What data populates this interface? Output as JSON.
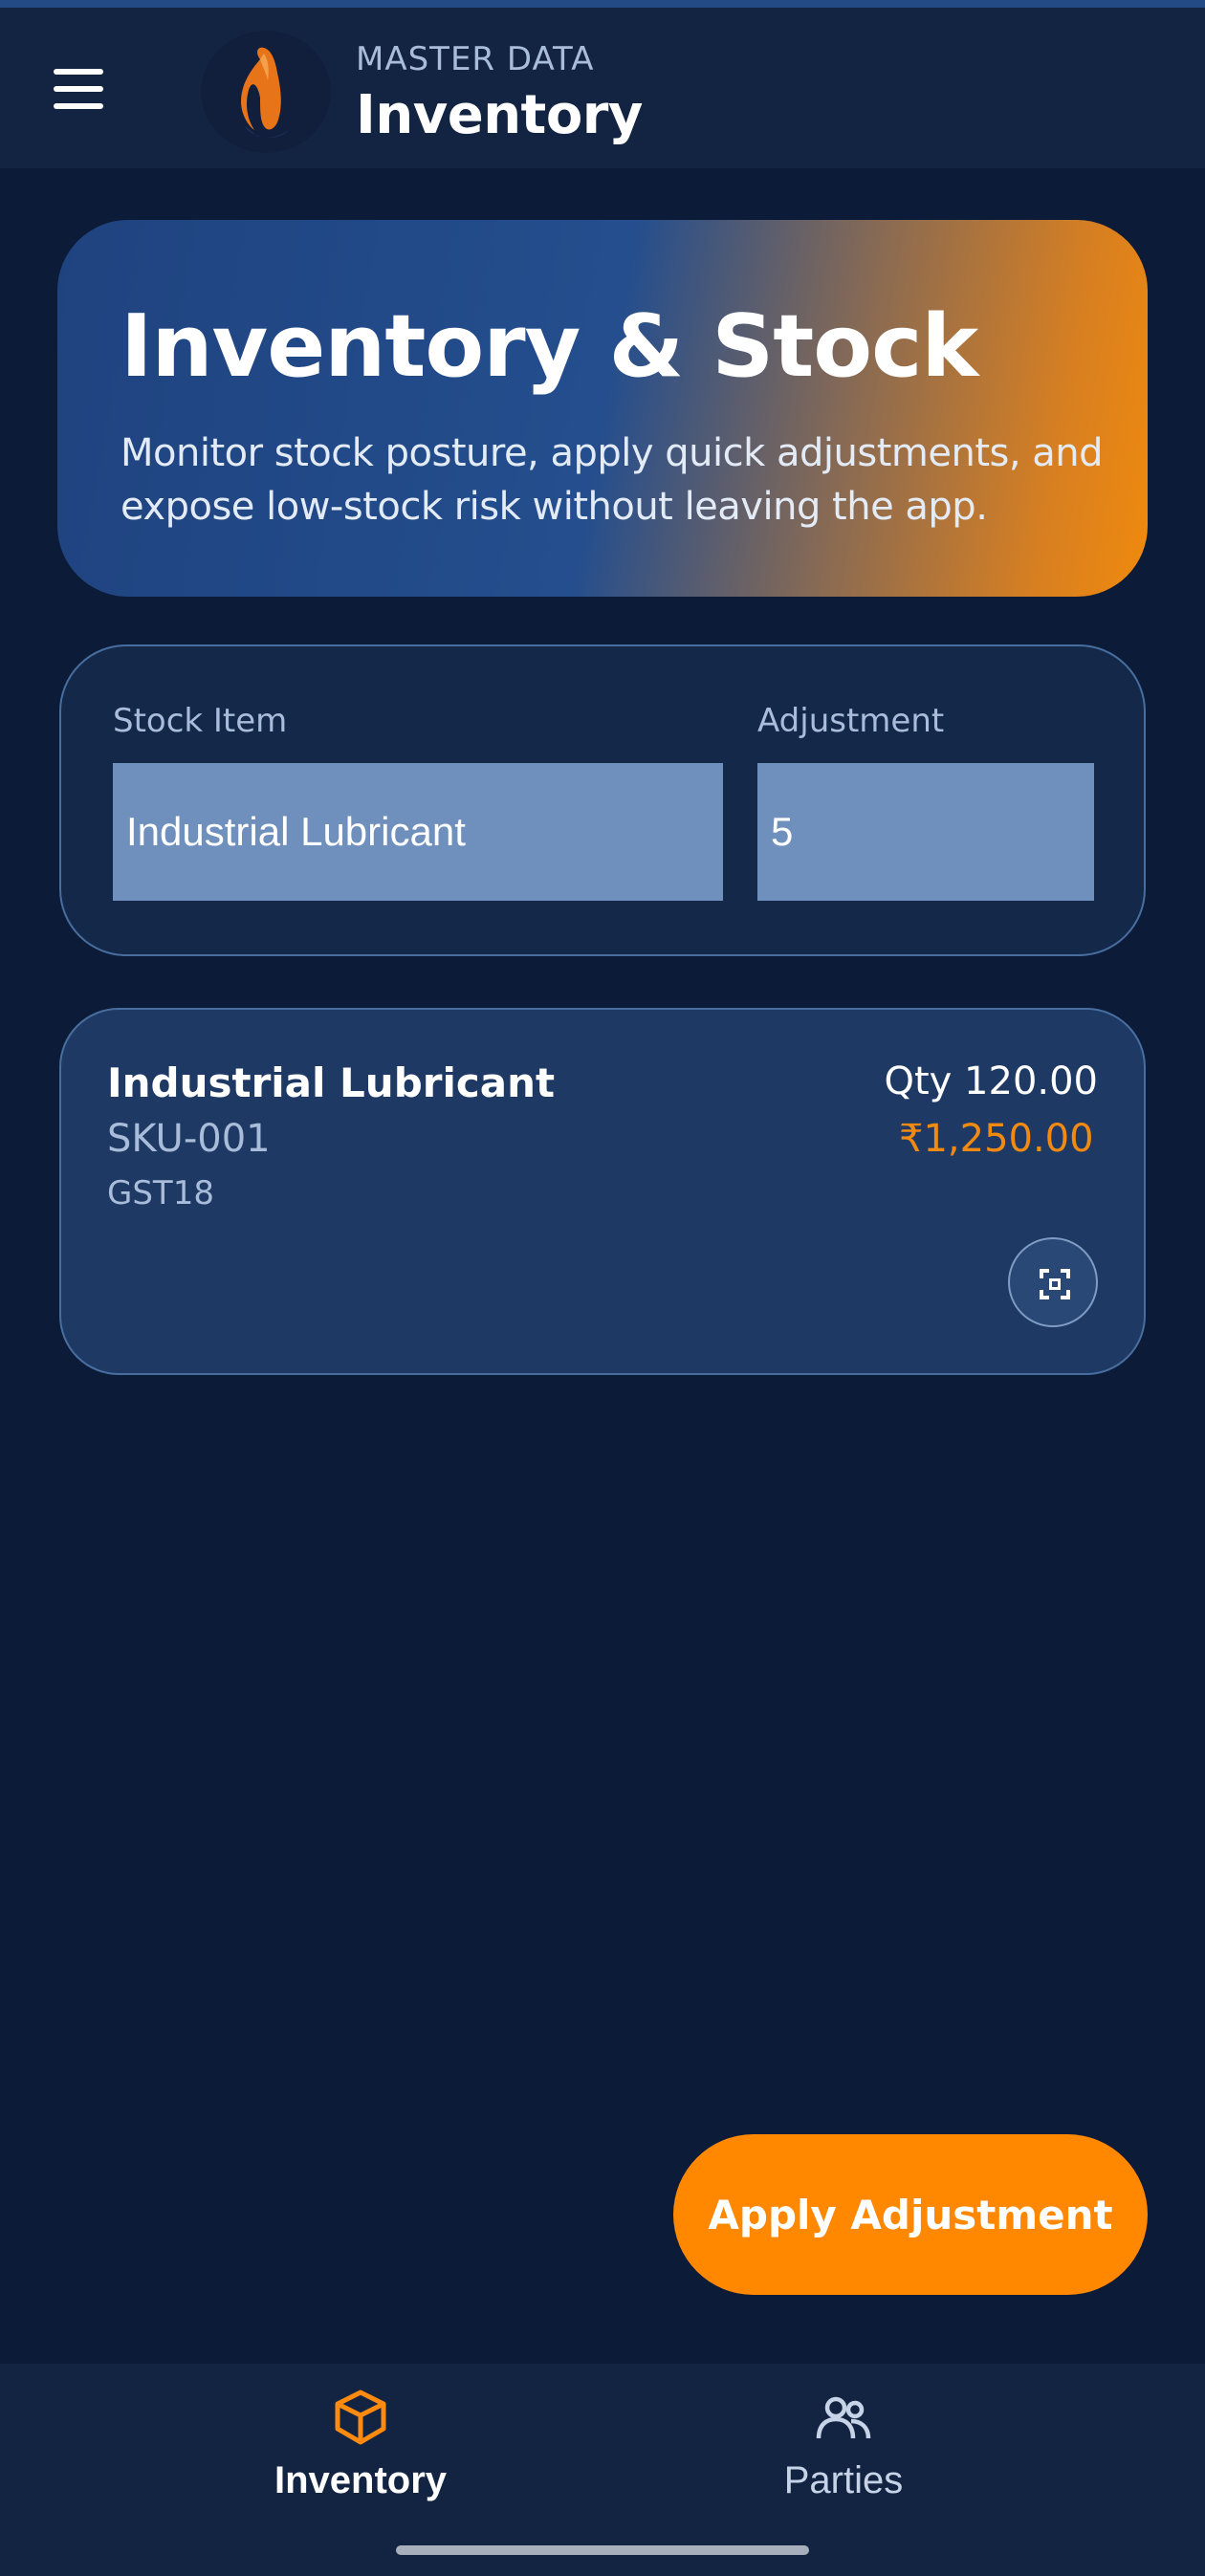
{
  "appbar": {
    "overline": "MASTER DATA",
    "title": "Inventory",
    "menu_icon": "hamburger-menu-icon",
    "logo_icon": "conch-shell-logo"
  },
  "hero": {
    "title": "Inventory & Stock",
    "subtitle": "Monitor stock posture, apply quick adjustments, and expose low-stock risk without leaving the app."
  },
  "form": {
    "stock_item_label": "Stock Item",
    "stock_item_value": "Industrial Lubricant",
    "adjustment_label": "Adjustment",
    "adjustment_value": "5"
  },
  "item": {
    "name": "Industrial Lubricant",
    "sku": "SKU-001",
    "tax": "GST18",
    "qty": "Qty 120.00",
    "price": "₹1,250.00",
    "action_icon": "scan-icon"
  },
  "fab": {
    "label": "Apply Adjustment"
  },
  "bottom_nav": [
    {
      "label": "Inventory",
      "icon": "cube-icon",
      "active": true
    },
    {
      "label": "Parties",
      "icon": "people-icon",
      "active": false
    }
  ],
  "colors": {
    "background": "#0c1b37",
    "bar": "#132443",
    "accent": "#ff8800",
    "card": "#1e3a64",
    "input": "#6f8fbd"
  }
}
